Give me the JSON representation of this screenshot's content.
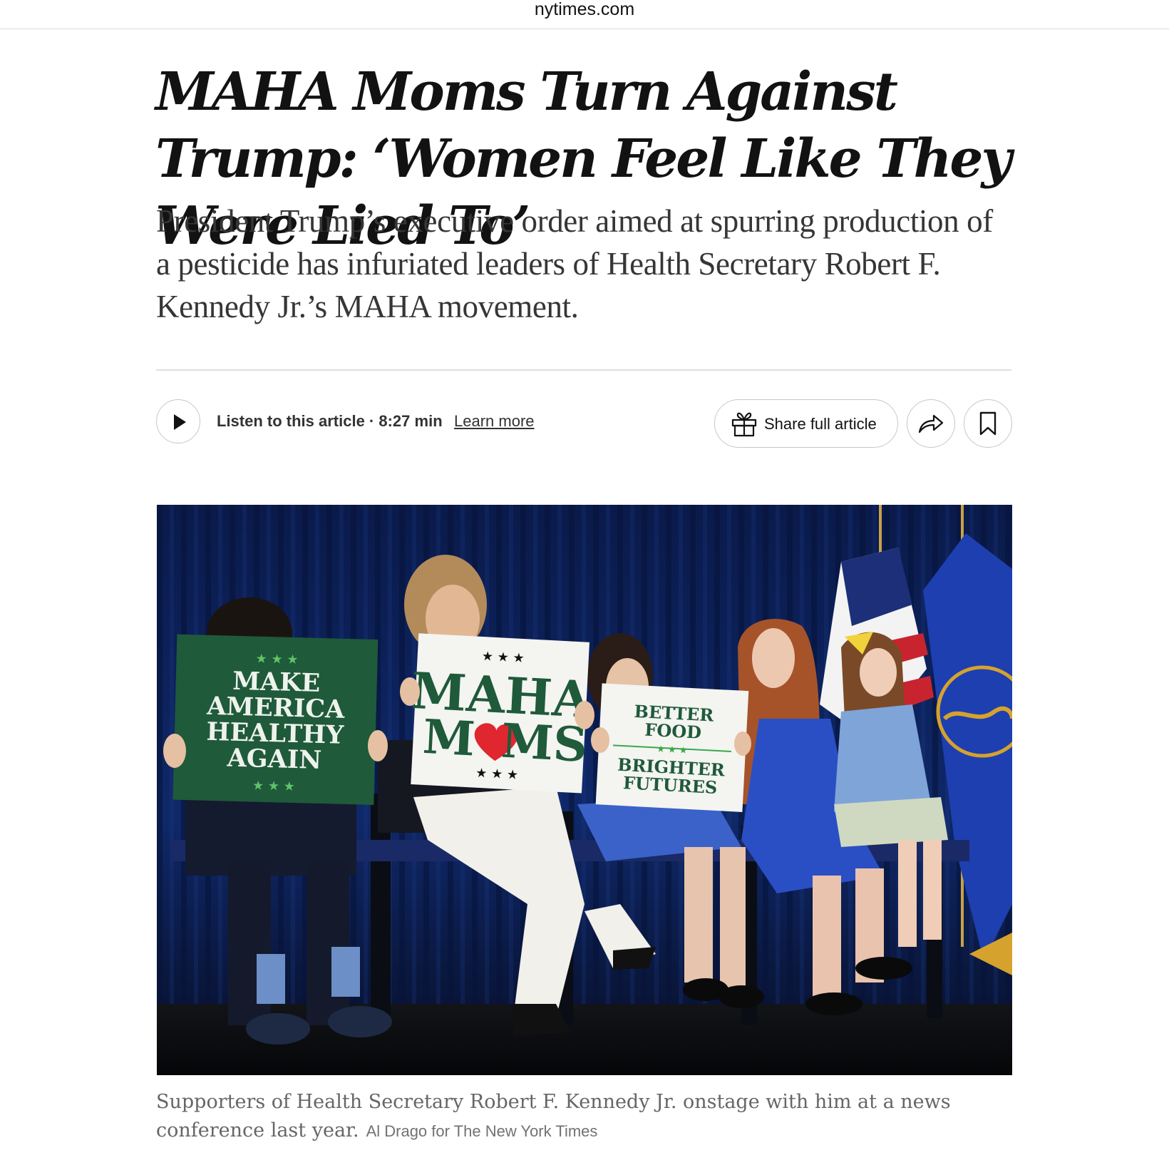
{
  "browser": {
    "domain": "nytimes.com"
  },
  "article": {
    "headline": "MAHA Moms Turn Against Trump: ‘Women Feel Like They Were Lied To’",
    "summary": "President Trump’s executive order aimed at spurring production of a pesticide has infuriated leaders of Health Secretary Robert F. Kennedy Jr.’s MAHA movement."
  },
  "toolbar": {
    "listen_label": "Listen to this article · 8:27 min",
    "learn_more_label": "Learn more",
    "share_full_label": "Share full article",
    "icons": {
      "play": "play-icon",
      "gift": "gift-icon",
      "share": "share-arrow-icon",
      "bookmark": "bookmark-icon"
    }
  },
  "photo": {
    "signs": {
      "green_sign": [
        "MAKE",
        "AMERICA",
        "HEALTHY",
        "AGAIN"
      ],
      "maha_sign_top": "MAHA",
      "maha_sign_bottom_left": "M",
      "maha_sign_bottom_right": "MS",
      "better_sign_top": [
        "BETTER",
        "FOOD"
      ],
      "better_sign_bottom": [
        "BRIGHTER",
        "FUTURES"
      ],
      "stars": "★ ★ ★"
    },
    "colors": {
      "curtain": "#0c1e52",
      "sign_green": "#1f5a3a",
      "heart": "#e0262f",
      "dress_blue": "#2a4fc4"
    }
  },
  "caption": {
    "text": "Supporters of Health Secretary Robert F. Kennedy Jr. onstage with him at a news conference last year.",
    "credit": "Al Drago for The New York Times"
  }
}
